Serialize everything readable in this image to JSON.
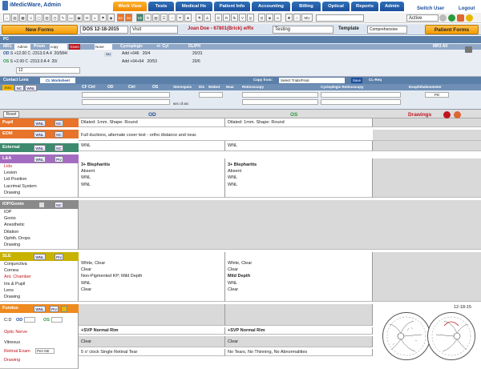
{
  "header": {
    "brand": "iMedicWare, Admin",
    "tabs": [
      "Work View",
      "Tests",
      "Medical Hx",
      "Patient Info",
      "Accounting",
      "Billing",
      "Optical",
      "Reports",
      "Admin"
    ],
    "active_tab": "Work View",
    "switch_user": "Switch User",
    "logout": "Logout",
    "status_value": "Active"
  },
  "toolbar": {
    "new_forms": "New Forms",
    "patient_forms": "Patient Forms",
    "dos_label": "DOS 12-18-2015",
    "visit_label": "Visit",
    "patient": "Joan Doe - 67801(Brick) e/Rx",
    "testing": "Testing",
    "template_label": "Template",
    "template_value": "Comprehensive"
  },
  "pc": {
    "label": "PC",
    "mr1": "MR1",
    "admin": "Admin",
    "prism": "Prism",
    "prism_val": "copy",
    "given": "Given",
    "none": "None",
    "cycloplegic": "Cycloplegic",
    "cyl": "+/- Cyl",
    "dlph": "DL/PH",
    "mr3": "MR3 All",
    "od_row": {
      "s": "+12.00",
      "c": "-2313.0",
      "a": "4",
      "v": "20/584/",
      "add": "+646",
      "va": "20/4",
      "dist": "20/31"
    },
    "os_row": {
      "s": "+2.00",
      "c": "-2313.0",
      "a": "4",
      "v": "20/",
      "add": "+64+64",
      "va": "20/53",
      "dist": "20/6"
    },
    "ou": "OU",
    "extra": "12"
  },
  "contact_lens": {
    "label": "Contact Lens",
    "worksheet": "CL Worksheet",
    "cf_ctrl": "CF Ctrl",
    "od": "OD",
    "ctrl": "Ctrl",
    "os": "OS",
    "stereopsis": "Stereopsis",
    "dis": "Dis",
    "w4dot": "W4Dot",
    "near": "Near",
    "retinoscopy": "Retinoscopy",
    "copy_from": "Copy from:",
    "select_trials": "Select Trials/Final",
    "save": "Save",
    "cl_req": "CL-Req",
    "cyclo_retino": "Cycloplegic Retinoscopy",
    "exophthalmometer": "Exophthalmometer",
    "sec_of_arc": "sec of arc",
    "pd": "PD"
  },
  "exam": {
    "reset": "Reset",
    "od_header": "OD",
    "os_header": "OS",
    "drawings": "Drawings",
    "wnl": "WNL",
    "nc": "NC",
    "prv": "Prv",
    "pupil": {
      "title": "Pupil",
      "od": "Dilated: 1mm. Shape: Round",
      "os": "Dilated: 1mm. Shape: Round"
    },
    "eom": {
      "title": "EOM",
      "od": "Full ductions, alternate cover test - ortho distance and near."
    },
    "external": {
      "title": "External",
      "od": "WNL",
      "os": "WNL"
    },
    "la": {
      "title": "L&A",
      "items": [
        "Lids",
        "Lesion",
        "Lid Position",
        "Lacrimal System",
        "Drawing"
      ],
      "od": [
        "3+ Blepharitis",
        "Absent",
        "WNL",
        "WNL"
      ],
      "os": [
        "3+ Blepharitis",
        "Absent",
        "WNL",
        "WNL"
      ]
    },
    "iop": {
      "title": "IOP/Gonio",
      "items": [
        "IOP",
        "Gonio",
        "Anesthetic",
        "Dilation",
        "Ophth. Drops",
        "Drawing"
      ]
    },
    "sle": {
      "title": "SLE",
      "items": [
        "Conjunctiva",
        "Cornea",
        "Ant. Chamber",
        "Iris & Pupil",
        "Lens",
        "Drawing"
      ],
      "od": [
        "White, Clear",
        "Clear",
        "Non-Pigmented KP; Mild Depth",
        "WNL",
        "Clear"
      ],
      "os": [
        "White, Clear",
        "Clear",
        "Mild Depth",
        "WNL",
        "Clear"
      ]
    },
    "fundus": {
      "title": "Fundus",
      "cd": "C:D",
      "od": "OD",
      "os": "OS",
      "items": [
        "Optic Nerve",
        "Vitreous",
        "Retinal Exam",
        "Drawing"
      ],
      "peri": "Peri NE",
      "od_vals": [
        "+SVP Normal Rim",
        "Clear",
        "5 o' clock Single Retinal Tear"
      ],
      "os_vals": [
        "+SVP Normal Rim",
        "Clear",
        "No Tears, No Thinning, No Abnormalities"
      ]
    },
    "drawing_date": "12-18-15"
  },
  "colors": {
    "pupil": "#e8732a",
    "eom": "#e8732a",
    "external": "#3d8a6e",
    "la": "#a46cc0",
    "iop": "#8a8a8a",
    "sle": "#c8b200",
    "fundus": "#ef8a1f"
  }
}
